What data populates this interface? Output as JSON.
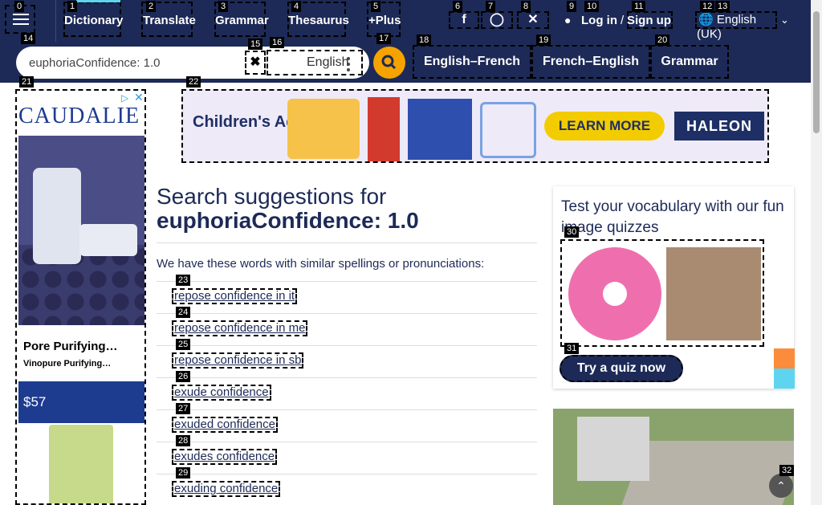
{
  "nav": {
    "links": [
      "Dictionary",
      "Translate",
      "Grammar",
      "Thesaurus",
      "+Plus"
    ],
    "login": "Log in",
    "separator": "/",
    "signup": "Sign up",
    "language": "English (UK)"
  },
  "search": {
    "query": "euphoriaConfidence: 1.0",
    "language": "English",
    "dict_links": [
      "English–French",
      "French–English",
      "Grammar"
    ]
  },
  "left_ad": {
    "brand": "CAUDALIE",
    "title": "Pore Purifying…",
    "subtitle": "Vinopure Purifying…",
    "price": "$57"
  },
  "top_ad": {
    "brand": "Children's Advil",
    "cta": "LEARN MORE",
    "sponsor": "HALEON"
  },
  "main": {
    "heading_prefix": "Search suggestions for",
    "heading_query": "euphoriaConfidence: 1.0",
    "intro": "We have these words with similar spellings or pronunciations:",
    "suggestions": [
      "repose confidence in it",
      "repose confidence in me",
      "repose confidence in sb",
      "exude confidence",
      "exuded confidence",
      "exudes confidence",
      "exuding confidence"
    ]
  },
  "quiz": {
    "title": "Test your vocabulary with our fun image quizzes",
    "button": "Try a quiz now"
  },
  "markers": [
    "0",
    "1",
    "2",
    "3",
    "4",
    "5",
    "6",
    "7",
    "8",
    "9",
    "10",
    "11",
    "12",
    "13",
    "14",
    "15",
    "16",
    "17",
    "18",
    "19",
    "20",
    "21",
    "22",
    "23",
    "24",
    "25",
    "26",
    "27",
    "28",
    "29",
    "30",
    "31",
    "32"
  ],
  "icons": [
    "menu-icon",
    "facebook-icon",
    "instagram-icon",
    "x-icon",
    "user-icon",
    "globe-icon",
    "chevron-down-icon",
    "clear-icon",
    "kebab-icon",
    "search-icon",
    "ad-choices-icon",
    "close-icon",
    "scroll-top-icon"
  ],
  "colors": {
    "nav_bg": "#1d2a57",
    "accent": "#f6a300",
    "text": "#1d2a57"
  }
}
